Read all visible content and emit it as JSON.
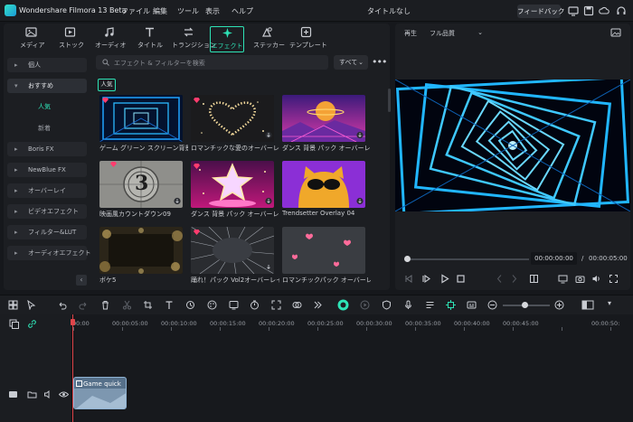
{
  "app": {
    "title": "Wondershare Filmora 13 Beta",
    "menu": [
      "ファイル",
      "編集",
      "ツール",
      "表示",
      "ヘルプ"
    ],
    "project_name": "タイトルなし",
    "feedback_label": "フィードバック"
  },
  "top_tabs": [
    {
      "label": "メディア",
      "icon": "media-icon"
    },
    {
      "label": "ストック",
      "icon": "stock-icon"
    },
    {
      "label": "オーディオ",
      "icon": "music-note-icon"
    },
    {
      "label": "タイトル",
      "icon": "title-T-icon"
    },
    {
      "label": "トランジション",
      "icon": "transition-icon"
    },
    {
      "label": "エフェクト",
      "icon": "effects-sparkle-icon",
      "active": true
    },
    {
      "label": "ステッカー",
      "icon": "sticker-icon"
    },
    {
      "label": "テンプレート",
      "icon": "template-icon"
    }
  ],
  "sidebar": {
    "items": [
      "個人",
      "おすすめ",
      "Boris FX",
      "NewBlue FX",
      "オーバーレイ",
      "ビデオエフェクト",
      "フィルター&LUT",
      "オーディオエフェクト"
    ],
    "sub_items": [
      "人気",
      "新着"
    ],
    "active_sub": "人気"
  },
  "search": {
    "placeholder": "エフェクト & フィルターを検索"
  },
  "filter": {
    "value": "すべて"
  },
  "section_label": "人気",
  "effects": [
    "ゲーム グリーン スクリーン背景オ…",
    "ロマンチックな愛のオーバーレイ 01",
    "ダンス 背景 パック オーバーレイ 01",
    "映画風カウントダウン09",
    "ダンス 背景 パック オーバーレイ 04",
    "Trendsetter Overlay 04",
    "ボケ5",
    "踊れ！パック Vol2オーバーレイ01",
    "ロマンチックパック オーバーレイ1"
  ],
  "countdown_number": "3",
  "preview": {
    "play_label": "再生",
    "quality": "フル品質",
    "current_time": "00:00:00:00",
    "separator": "/",
    "total_time": "00:00:05:00"
  },
  "timeline": {
    "ruler": [
      "00:00",
      "00:00:05:00",
      "00:00:10:00",
      "00:00:15:00",
      "00:00:20:00",
      "00:00:25:00",
      "00:00:30:00",
      "00:00:35:00",
      "00:00:40:00",
      "00:00:45:00",
      "00:00:50:"
    ],
    "clip_title": "Game quick"
  },
  "colors": {
    "accent": "#2ee3b6",
    "playhead": "#e0454a"
  }
}
